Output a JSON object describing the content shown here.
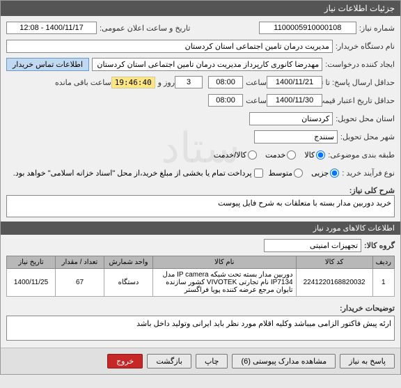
{
  "window": {
    "title": "جزئیات اطلاعات نیاز"
  },
  "header": {
    "needNumberLabel": "شماره نیاز:",
    "needNumber": "1100005910000108",
    "announceLabel": "تاریخ و ساعت اعلان عمومی:",
    "announceValue": "1400/11/17 - 12:08",
    "buyerLabel": "نام دستگاه خریدار:",
    "buyerValue": "مدیریت درمان تامین اجتماعی استان کردستان",
    "requesterLabel": "ایجاد کننده درخواست:",
    "requesterValue": "مهدرضا کانوری کارپرداز مدیریت درمان تامین اجتماعی استان کردستان",
    "contactBtn": "اطلاعات تماس خریدار",
    "deadlineLabel": "حداقل ارسال پاسخ: تا تاریخ:",
    "deadlineDate": "1400/11/21",
    "timeLabel": "ساعت",
    "deadlineTime": "08:00",
    "daysLeft": "3",
    "daysUnit": "روز و",
    "countdown": "19:46:40",
    "remainingText": "ساعت باقی مانده",
    "validityLabel": "حداقل تاریخ اعتبار قیمت: تا تاریخ:",
    "validityDate": "1400/11/30",
    "validityTime": "08:00",
    "provinceLabel": "استان محل تحویل:",
    "provinceValue": "کردستان",
    "cityLabel": "شهر محل تحویل:",
    "cityValue": "سنندج",
    "classifyLabel": "طبقه بندی موضوعی:",
    "radios": {
      "goods": "کالا",
      "service": "خدمت",
      "both": "کالا/خدمت"
    },
    "processLabel": "نوع فرآیند خرید :",
    "procRadios": {
      "low": "جزیی",
      "mid": "متوسط"
    },
    "paymentNote": "پرداخت تمام یا بخشی از مبلغ خرید،از محل \"اسناد خزانه اسلامی\" خواهد بود."
  },
  "descSection": {
    "label": "شرح کلی نیاز:",
    "text": "خرید دوربین مدار بسته با متعلقات به شرح فایل پیوست"
  },
  "itemsSection": {
    "title": "اطلاعات کالاهای مورد نیاز",
    "groupLabel": "گروه کالا:",
    "groupValue": "تجهیزات امنیتی",
    "cols": {
      "row": "ردیف",
      "code": "کد کالا",
      "name": "نام کالا",
      "unit": "واحد شمارش",
      "qty": "تعداد / مقدار",
      "date": "تاریخ نیاز"
    },
    "rows": [
      {
        "idx": "1",
        "code": "2241220168820032",
        "name": "دوربین مدار بسته تحت شبکه IP camera مدل IP7134 نام تجارتی VIVOTEK کشور سازنده تایوان مرجع عرضه کننده پویا فراگستر",
        "unit": "دستگاه",
        "qty": "67",
        "date": "1400/11/25"
      }
    ]
  },
  "notesSection": {
    "label": "توضیحات خریدار:",
    "text": "ارئه پیش فاکتور الزامی میباشد وکلیه اقلام مورد نظر باید ایرانی وتولید داخل باشد"
  },
  "footer": {
    "reply": "پاسخ به نیاز",
    "attachments": "مشاهده مدارک پیوستی (6)",
    "print": "چاپ",
    "back": "بازگشت",
    "exit": "خروج"
  },
  "watermark": "ستاد"
}
